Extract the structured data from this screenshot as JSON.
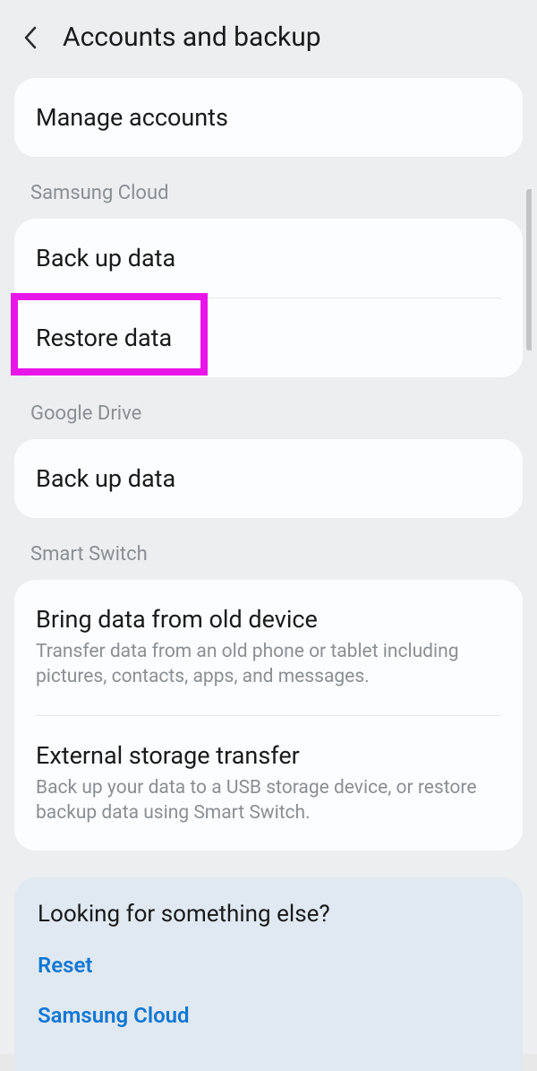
{
  "header": {
    "title": "Accounts and backup"
  },
  "manage": {
    "title": "Manage accounts"
  },
  "sections": {
    "samsungCloud": "Samsung Cloud",
    "googleDrive": "Google Drive",
    "smartSwitch": "Smart Switch"
  },
  "samsungCloud": {
    "backup": "Back up data",
    "restore": "Restore data"
  },
  "googleDrive": {
    "backup": "Back up data"
  },
  "smartSwitch": {
    "bring": {
      "title": "Bring data from old device",
      "desc": "Transfer data from an old phone or tablet including pictures, contacts, apps, and messages."
    },
    "external": {
      "title": "External storage transfer",
      "desc": "Back up your data to a USB storage device, or restore backup data using Smart Switch."
    }
  },
  "footer": {
    "title": "Looking for something else?",
    "reset": "Reset",
    "samsungCloud": "Samsung Cloud"
  },
  "highlight": {
    "color": "#e815e8"
  }
}
